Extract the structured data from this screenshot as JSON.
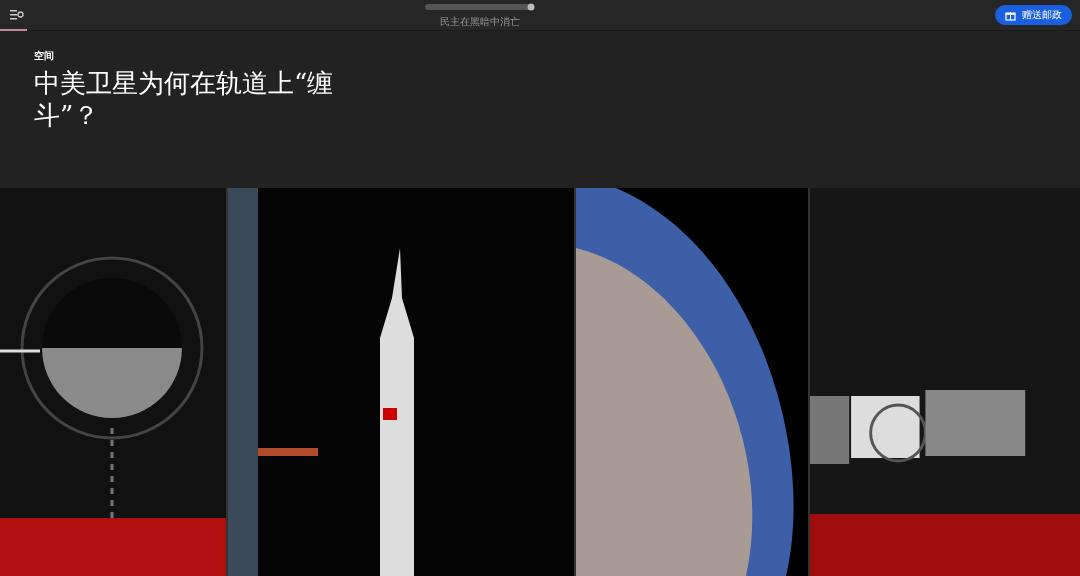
{
  "header": {
    "tagline": "民主在黑暗中消亡",
    "gift_button": "赠送邮政",
    "reading_progress": {
      "level": 0.025
    }
  },
  "article": {
    "section": "空间",
    "title": "中美卫星为何在轨道上“缠斗”？"
  },
  "gallery": [
    {
      "kind": "moon"
    },
    {
      "kind": "rocket"
    },
    {
      "kind": "earth"
    },
    {
      "kind": "satellite"
    }
  ]
}
